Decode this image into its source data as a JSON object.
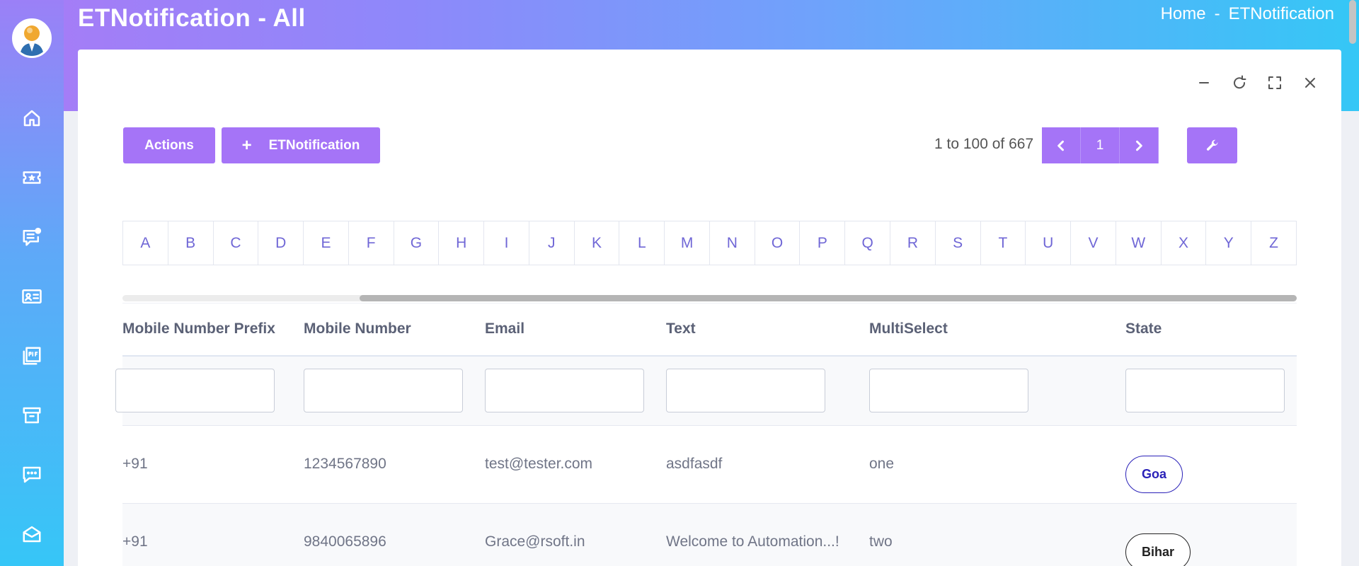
{
  "page": {
    "title": "ETNotification - All"
  },
  "breadcrumb": {
    "home": "Home",
    "separator": "-",
    "current": "ETNotification"
  },
  "toolbar": {
    "actions_label": "Actions",
    "add_label": "ETNotification",
    "pagination_info": "1 to 100 of 667",
    "current_page": "1"
  },
  "alphabet": [
    "A",
    "B",
    "C",
    "D",
    "E",
    "F",
    "G",
    "H",
    "I",
    "J",
    "K",
    "L",
    "M",
    "N",
    "O",
    "P",
    "Q",
    "R",
    "S",
    "T",
    "U",
    "V",
    "W",
    "X",
    "Y",
    "Z"
  ],
  "table": {
    "columns": [
      "Mobile Number Prefix",
      "Mobile Number",
      "Email",
      "Text",
      "MultiSelect",
      "State"
    ],
    "rows": [
      {
        "prefix": "+91",
        "mobile": "1234567890",
        "email": "test@tester.com",
        "text": "asdfasdf",
        "multiselect": "one",
        "state": "Goa"
      },
      {
        "prefix": "+91",
        "mobile": "9840065896",
        "email": "Grace@rsoft.in",
        "text": "Welcome to Automation...!",
        "multiselect": "two",
        "state": "Bihar"
      }
    ]
  },
  "icons": {
    "sidebar": [
      "home-icon",
      "ticket-icon",
      "notes-icon",
      "id-card-icon",
      "pdf-icon",
      "archive-icon",
      "chat-icon",
      "mail-icon"
    ],
    "card_tools": [
      "minimize-icon",
      "refresh-icon",
      "fullscreen-icon",
      "close-icon"
    ]
  },
  "colors": {
    "accent": "#a574f7",
    "badge_goa": "#2a21b8",
    "badge_bihar": "#222222"
  }
}
